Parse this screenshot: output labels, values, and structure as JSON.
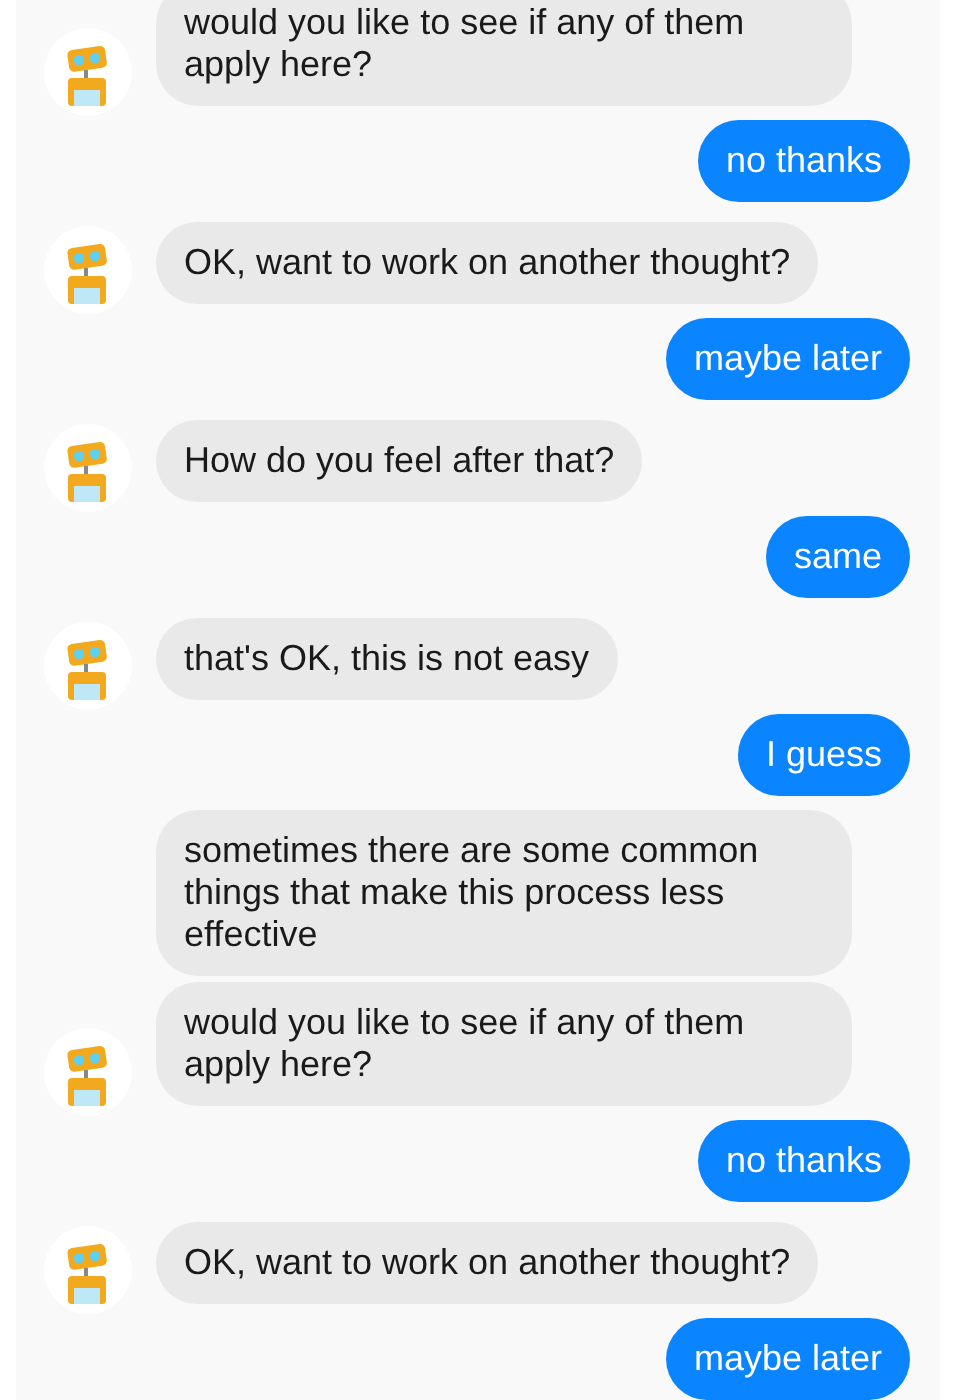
{
  "messages": [
    {
      "kind": "bot",
      "text": "would you like to see if any of them apply here?",
      "avatar": true
    },
    {
      "kind": "user",
      "text": "no thanks"
    },
    {
      "kind": "bot",
      "text": "OK, want to work on another thought?",
      "avatar": true
    },
    {
      "kind": "user",
      "text": "maybe later"
    },
    {
      "kind": "bot",
      "text": "How do you feel after that?",
      "avatar": true
    },
    {
      "kind": "user",
      "text": "same"
    },
    {
      "kind": "bot",
      "text": "that's OK, this is not easy",
      "avatar": true
    },
    {
      "kind": "user",
      "text": "I guess"
    },
    {
      "kind": "bot",
      "text": "sometimes there are some common things that make this process less effective",
      "avatar": false
    },
    {
      "kind": "bot",
      "text": "would you like to see if any of them apply here?",
      "avatar": true
    },
    {
      "kind": "user",
      "text": "no thanks"
    },
    {
      "kind": "bot",
      "text": "OK, want to work on another thought?",
      "avatar": true
    },
    {
      "kind": "user",
      "text": "maybe later"
    }
  ]
}
